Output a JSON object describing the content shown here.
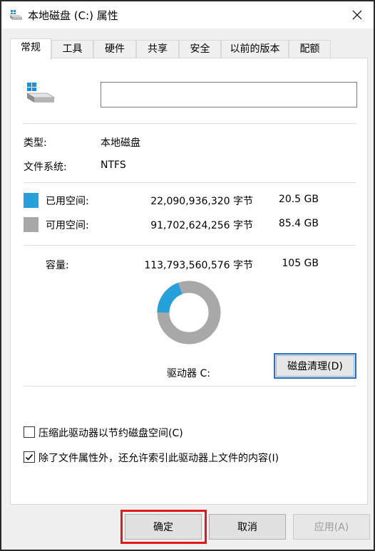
{
  "window": {
    "title": "本地磁盘 (C:) 属性"
  },
  "tabs": [
    {
      "label": "常规",
      "active": true
    },
    {
      "label": "工具"
    },
    {
      "label": "硬件"
    },
    {
      "label": "共享"
    },
    {
      "label": "安全"
    },
    {
      "label": "以前的版本"
    },
    {
      "label": "配额"
    }
  ],
  "general": {
    "name_value": "",
    "type_label": "类型:",
    "type_value": "本地磁盘",
    "fs_label": "文件系统:",
    "fs_value": "NTFS",
    "used": {
      "label": "已用空间:",
      "bytes": "22,090,936,320 字节",
      "size": "20.5 GB",
      "color": "#26a0da"
    },
    "free": {
      "label": "可用空间:",
      "bytes": "91,702,624,256 字节",
      "size": "85.4 GB",
      "color": "#a8a8a8"
    },
    "capacity": {
      "label": "容量:",
      "bytes": "113,793,560,576 字节",
      "size": "105 GB"
    },
    "drive_label": "驱动器 C:",
    "cleanup_button": "磁盘清理(D)",
    "used_fraction": 0.194,
    "compress": {
      "label": "压缩此驱动器以节约磁盘空间(C)",
      "checked": false
    },
    "index": {
      "label": "除了文件属性外，还允许索引此驱动器上文件的内容(I)",
      "checked": true
    }
  },
  "footer": {
    "ok": "确定",
    "cancel": "取消",
    "apply": "应用(A)"
  }
}
